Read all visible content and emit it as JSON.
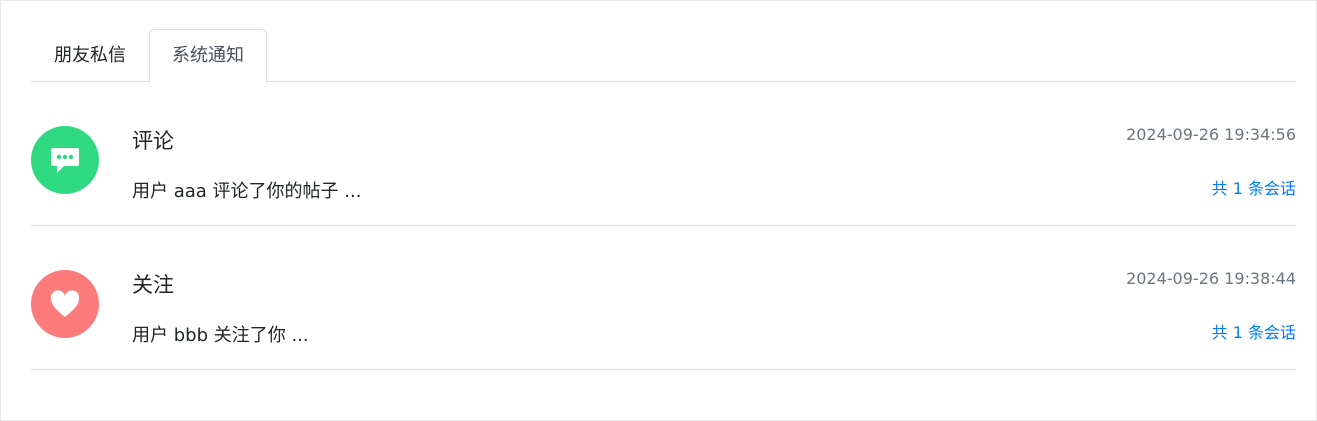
{
  "tabs": [
    {
      "label": "朋友私信"
    },
    {
      "label": "系统通知"
    }
  ],
  "colors": {
    "comment_avatar": "#2fd982",
    "follow_avatar": "#fe7b7b",
    "link": "#007bff",
    "muted": "#6c757d"
  },
  "notices": [
    {
      "icon": "chat-bubble-icon",
      "title": "评论",
      "summary": "用户 aaa 评论了你的帖子 ...",
      "time": "2024-09-26 19:34:56",
      "count": "共 1 条会话"
    },
    {
      "icon": "heart-icon",
      "title": "关注",
      "summary": "用户 bbb 关注了你 ...",
      "time": "2024-09-26 19:38:44",
      "count": "共 1 条会话"
    }
  ]
}
